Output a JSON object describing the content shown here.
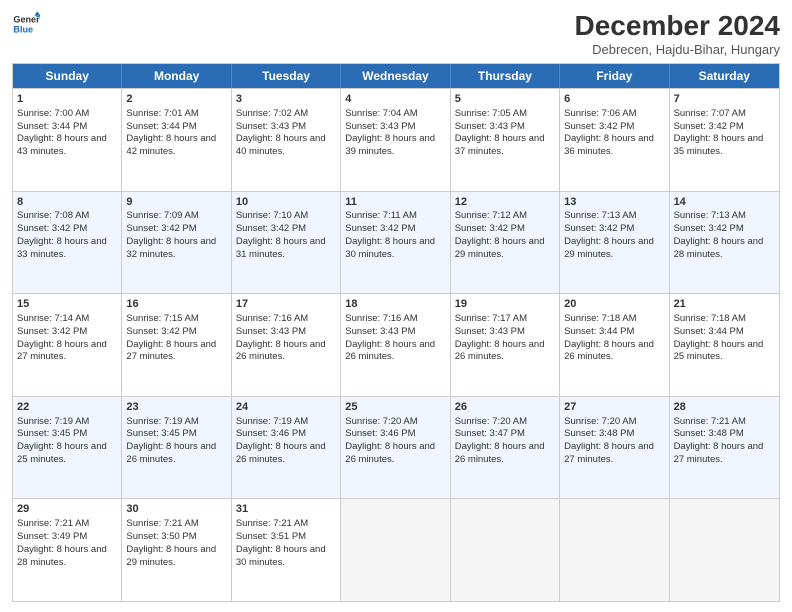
{
  "header": {
    "logo_line1": "General",
    "logo_line2": "Blue",
    "month_title": "December 2024",
    "location": "Debrecen, Hajdu-Bihar, Hungary"
  },
  "days_of_week": [
    "Sunday",
    "Monday",
    "Tuesday",
    "Wednesday",
    "Thursday",
    "Friday",
    "Saturday"
  ],
  "weeks": [
    [
      {
        "day": "1",
        "sunrise": "Sunrise: 7:00 AM",
        "sunset": "Sunset: 3:44 PM",
        "daylight": "Daylight: 8 hours and 43 minutes."
      },
      {
        "day": "2",
        "sunrise": "Sunrise: 7:01 AM",
        "sunset": "Sunset: 3:44 PM",
        "daylight": "Daylight: 8 hours and 42 minutes."
      },
      {
        "day": "3",
        "sunrise": "Sunrise: 7:02 AM",
        "sunset": "Sunset: 3:43 PM",
        "daylight": "Daylight: 8 hours and 40 minutes."
      },
      {
        "day": "4",
        "sunrise": "Sunrise: 7:04 AM",
        "sunset": "Sunset: 3:43 PM",
        "daylight": "Daylight: 8 hours and 39 minutes."
      },
      {
        "day": "5",
        "sunrise": "Sunrise: 7:05 AM",
        "sunset": "Sunset: 3:43 PM",
        "daylight": "Daylight: 8 hours and 37 minutes."
      },
      {
        "day": "6",
        "sunrise": "Sunrise: 7:06 AM",
        "sunset": "Sunset: 3:42 PM",
        "daylight": "Daylight: 8 hours and 36 minutes."
      },
      {
        "day": "7",
        "sunrise": "Sunrise: 7:07 AM",
        "sunset": "Sunset: 3:42 PM",
        "daylight": "Daylight: 8 hours and 35 minutes."
      }
    ],
    [
      {
        "day": "8",
        "sunrise": "Sunrise: 7:08 AM",
        "sunset": "Sunset: 3:42 PM",
        "daylight": "Daylight: 8 hours and 33 minutes."
      },
      {
        "day": "9",
        "sunrise": "Sunrise: 7:09 AM",
        "sunset": "Sunset: 3:42 PM",
        "daylight": "Daylight: 8 hours and 32 minutes."
      },
      {
        "day": "10",
        "sunrise": "Sunrise: 7:10 AM",
        "sunset": "Sunset: 3:42 PM",
        "daylight": "Daylight: 8 hours and 31 minutes."
      },
      {
        "day": "11",
        "sunrise": "Sunrise: 7:11 AM",
        "sunset": "Sunset: 3:42 PM",
        "daylight": "Daylight: 8 hours and 30 minutes."
      },
      {
        "day": "12",
        "sunrise": "Sunrise: 7:12 AM",
        "sunset": "Sunset: 3:42 PM",
        "daylight": "Daylight: 8 hours and 29 minutes."
      },
      {
        "day": "13",
        "sunrise": "Sunrise: 7:13 AM",
        "sunset": "Sunset: 3:42 PM",
        "daylight": "Daylight: 8 hours and 29 minutes."
      },
      {
        "day": "14",
        "sunrise": "Sunrise: 7:13 AM",
        "sunset": "Sunset: 3:42 PM",
        "daylight": "Daylight: 8 hours and 28 minutes."
      }
    ],
    [
      {
        "day": "15",
        "sunrise": "Sunrise: 7:14 AM",
        "sunset": "Sunset: 3:42 PM",
        "daylight": "Daylight: 8 hours and 27 minutes."
      },
      {
        "day": "16",
        "sunrise": "Sunrise: 7:15 AM",
        "sunset": "Sunset: 3:42 PM",
        "daylight": "Daylight: 8 hours and 27 minutes."
      },
      {
        "day": "17",
        "sunrise": "Sunrise: 7:16 AM",
        "sunset": "Sunset: 3:43 PM",
        "daylight": "Daylight: 8 hours and 26 minutes."
      },
      {
        "day": "18",
        "sunrise": "Sunrise: 7:16 AM",
        "sunset": "Sunset: 3:43 PM",
        "daylight": "Daylight: 8 hours and 26 minutes."
      },
      {
        "day": "19",
        "sunrise": "Sunrise: 7:17 AM",
        "sunset": "Sunset: 3:43 PM",
        "daylight": "Daylight: 8 hours and 26 minutes."
      },
      {
        "day": "20",
        "sunrise": "Sunrise: 7:18 AM",
        "sunset": "Sunset: 3:44 PM",
        "daylight": "Daylight: 8 hours and 26 minutes."
      },
      {
        "day": "21",
        "sunrise": "Sunrise: 7:18 AM",
        "sunset": "Sunset: 3:44 PM",
        "daylight": "Daylight: 8 hours and 25 minutes."
      }
    ],
    [
      {
        "day": "22",
        "sunrise": "Sunrise: 7:19 AM",
        "sunset": "Sunset: 3:45 PM",
        "daylight": "Daylight: 8 hours and 25 minutes."
      },
      {
        "day": "23",
        "sunrise": "Sunrise: 7:19 AM",
        "sunset": "Sunset: 3:45 PM",
        "daylight": "Daylight: 8 hours and 26 minutes."
      },
      {
        "day": "24",
        "sunrise": "Sunrise: 7:19 AM",
        "sunset": "Sunset: 3:46 PM",
        "daylight": "Daylight: 8 hours and 26 minutes."
      },
      {
        "day": "25",
        "sunrise": "Sunrise: 7:20 AM",
        "sunset": "Sunset: 3:46 PM",
        "daylight": "Daylight: 8 hours and 26 minutes."
      },
      {
        "day": "26",
        "sunrise": "Sunrise: 7:20 AM",
        "sunset": "Sunset: 3:47 PM",
        "daylight": "Daylight: 8 hours and 26 minutes."
      },
      {
        "day": "27",
        "sunrise": "Sunrise: 7:20 AM",
        "sunset": "Sunset: 3:48 PM",
        "daylight": "Daylight: 8 hours and 27 minutes."
      },
      {
        "day": "28",
        "sunrise": "Sunrise: 7:21 AM",
        "sunset": "Sunset: 3:48 PM",
        "daylight": "Daylight: 8 hours and 27 minutes."
      }
    ],
    [
      {
        "day": "29",
        "sunrise": "Sunrise: 7:21 AM",
        "sunset": "Sunset: 3:49 PM",
        "daylight": "Daylight: 8 hours and 28 minutes."
      },
      {
        "day": "30",
        "sunrise": "Sunrise: 7:21 AM",
        "sunset": "Sunset: 3:50 PM",
        "daylight": "Daylight: 8 hours and 29 minutes."
      },
      {
        "day": "31",
        "sunrise": "Sunrise: 7:21 AM",
        "sunset": "Sunset: 3:51 PM",
        "daylight": "Daylight: 8 hours and 30 minutes."
      },
      null,
      null,
      null,
      null
    ]
  ]
}
